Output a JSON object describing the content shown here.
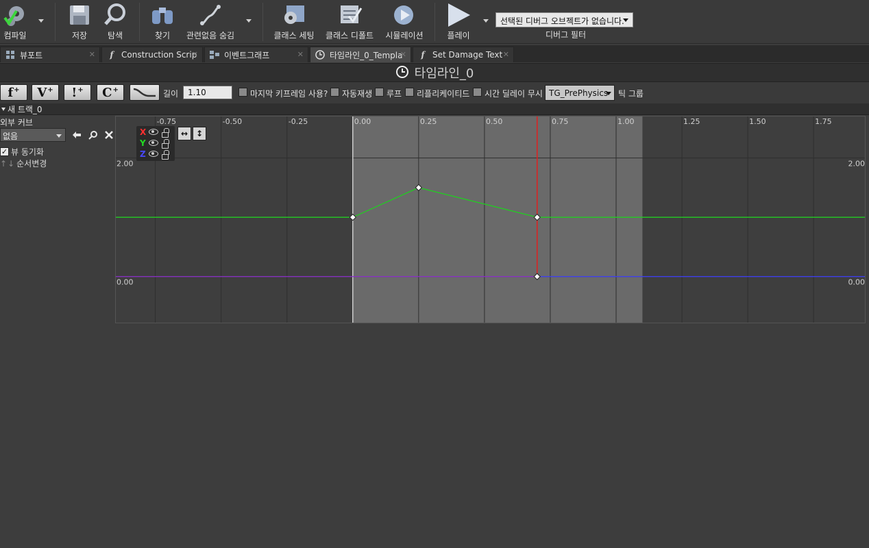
{
  "toolbar": {
    "compile": "컴파일",
    "save": "저장",
    "browse": "탐색",
    "find": "찾기",
    "hide_unrelated": "관련없음 숨김",
    "class_settings": "클래스 세팅",
    "class_defaults": "클래스 디폴트",
    "simulation": "시뮬레이션",
    "play": "플레이",
    "debug_object": "선택된 디버그 오브젝트가 없습니다.",
    "debug_filter": "디버그 필터"
  },
  "tabs": [
    {
      "label": "뷰포트",
      "icon": "viewport-icon"
    },
    {
      "label": "Construction Scrip",
      "icon": "function-icon"
    },
    {
      "label": "이벤트그래프",
      "icon": "graph-icon"
    },
    {
      "label": "타임라인_0_Templa",
      "icon": "clock-icon"
    },
    {
      "label": "Set Damage Text",
      "icon": "function-icon"
    }
  ],
  "timeline": {
    "title": "타임라인_0"
  },
  "options": {
    "add_buttons": [
      "f",
      "V",
      "!",
      "C"
    ],
    "length_label": "길이",
    "length_value": "1.10",
    "use_last_keyframe": "마지막 키프레임 사용?",
    "autoplay": "자동재생",
    "loop": "루프",
    "replicated": "리플리케이티드",
    "ignore_time_dilation": "시간 딜레이 무시",
    "tick_group_value": "TG_PrePhysics",
    "tick_group_label": "틱 그룹"
  },
  "track": {
    "name": "새 트랙_0",
    "external_curve_label": "외부 커브",
    "curve_value": "없음",
    "sync_view": "뷰 동기화",
    "reorder": "순서변경"
  },
  "graph": {
    "x_ticks": [
      "-0.75",
      "-0.50",
      "-0.25",
      "0.00",
      "0.25",
      "0.50",
      "0.75",
      "1.00",
      "1.25",
      "1.50",
      "1.75"
    ],
    "y_top_label": "2.00",
    "y_bottom_label": "0.00",
    "channels": [
      "X",
      "Y",
      "Z"
    ],
    "colors": {
      "x": "#ff3030",
      "y": "#22cc22",
      "z": "#4040ff",
      "playhead": "#e02020",
      "purple_line": "#9030d0"
    }
  },
  "chart_data": {
    "type": "line",
    "x_range": [
      -0.9,
      1.95
    ],
    "y_range": [
      -0.8,
      2.7
    ],
    "length": 1.1,
    "playhead": 0.7,
    "series": [
      {
        "values": [
          [
            0.0,
            1.0
          ],
          [
            0.25,
            1.5
          ],
          [
            0.7,
            1.0
          ]
        ],
        "color": "#22cc22"
      },
      {
        "values": [
          [
            0.7,
            0.0
          ]
        ],
        "color": "#9030d0"
      }
    ]
  }
}
